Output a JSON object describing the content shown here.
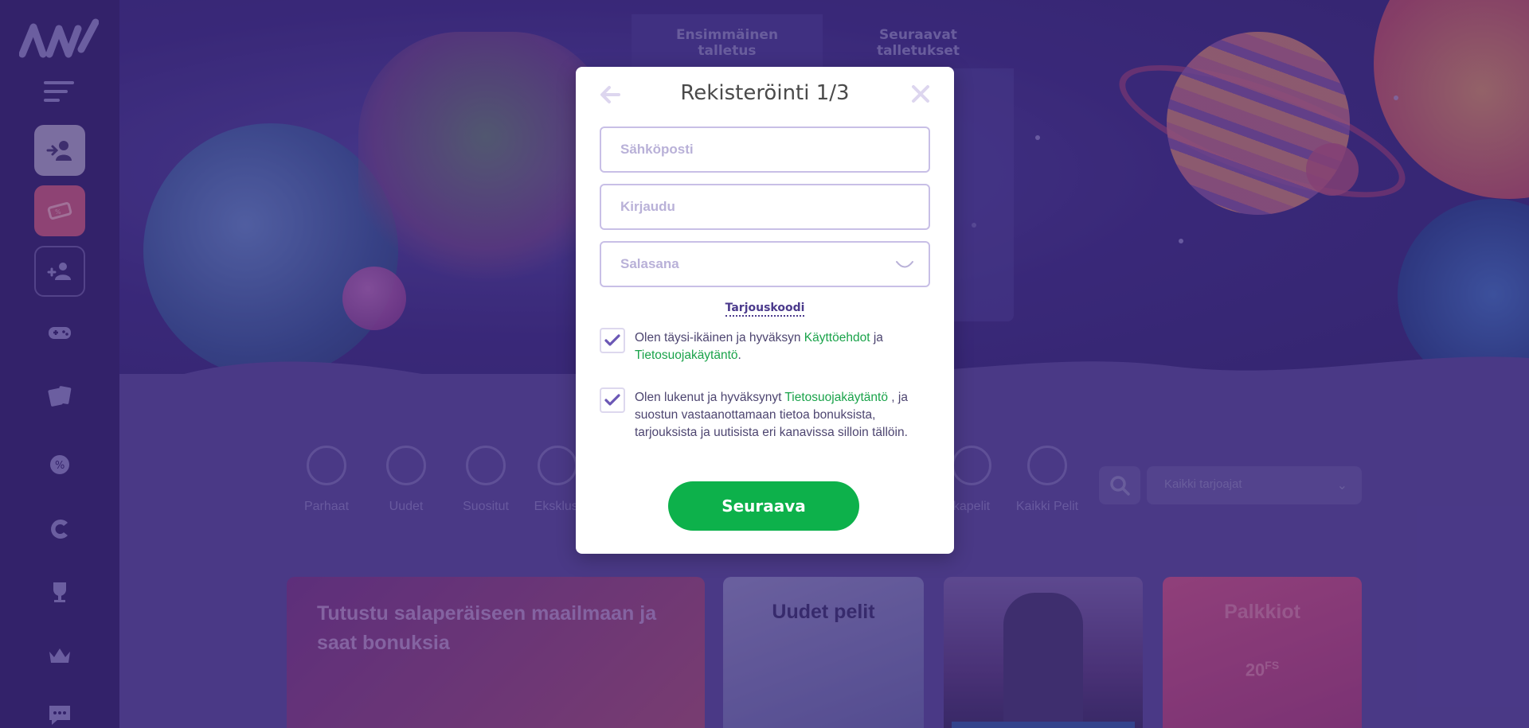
{
  "deposit_tabs": [
    {
      "line1": "Ensimmäinen",
      "line2": "talletus"
    },
    {
      "line1": "Seuraavat",
      "line2": "talletukset"
    }
  ],
  "categories": [
    {
      "label": "Parhaat",
      "icon": "star-circle-icon"
    },
    {
      "label": "Uudet",
      "icon": "new-badge-icon"
    },
    {
      "label": "Suositut",
      "icon": "star-icon"
    },
    {
      "label": "Eksklusi",
      "icon": "exclusive-badge-icon"
    },
    {
      "label": "kapelit",
      "icon": "joystick-icon"
    },
    {
      "label": "Kaikki Pelit",
      "icon": "spade-icon"
    }
  ],
  "provider_select": {
    "value": "Kaikki tarjoajat"
  },
  "cards": {
    "card1_title": "Tutustu salaperäiseen maailmaan ja saat bonuksia",
    "card2_title": "Uudet pelit",
    "card4_title": "Palkkiot",
    "card4_fs_value": "20",
    "card4_fs_unit": "FS"
  },
  "modal": {
    "title": "Rekisteröinti 1/3",
    "email_placeholder": "Sähköposti",
    "login_placeholder": "Kirjaudu",
    "password_placeholder": "Salasana",
    "promo_link": "Tarjouskoodi",
    "consent1": {
      "text_before": "Olen täysi-ikäinen ja hyväksyn ",
      "link1": "Käyttöehdot",
      "text_mid": " ja ",
      "link2": "Tietosuojakäytäntö",
      "text_after": ".",
      "checked": true
    },
    "consent2": {
      "text_before": "Olen lukenut ja hyväksynyt ",
      "link1": "Tietosuojakäytäntö",
      "text_after": " , ja suostun vastaanottamaan tietoa bonuksista, tarjouksista ja uutisista eri kanavissa silloin tällöin.",
      "checked": true
    },
    "next_button": "Seuraava"
  },
  "colors": {
    "accent_green": "#0db14b",
    "link_green": "#1aa34a",
    "sidebar_bg": "#3a2773",
    "promo_button": "#c55a83"
  }
}
